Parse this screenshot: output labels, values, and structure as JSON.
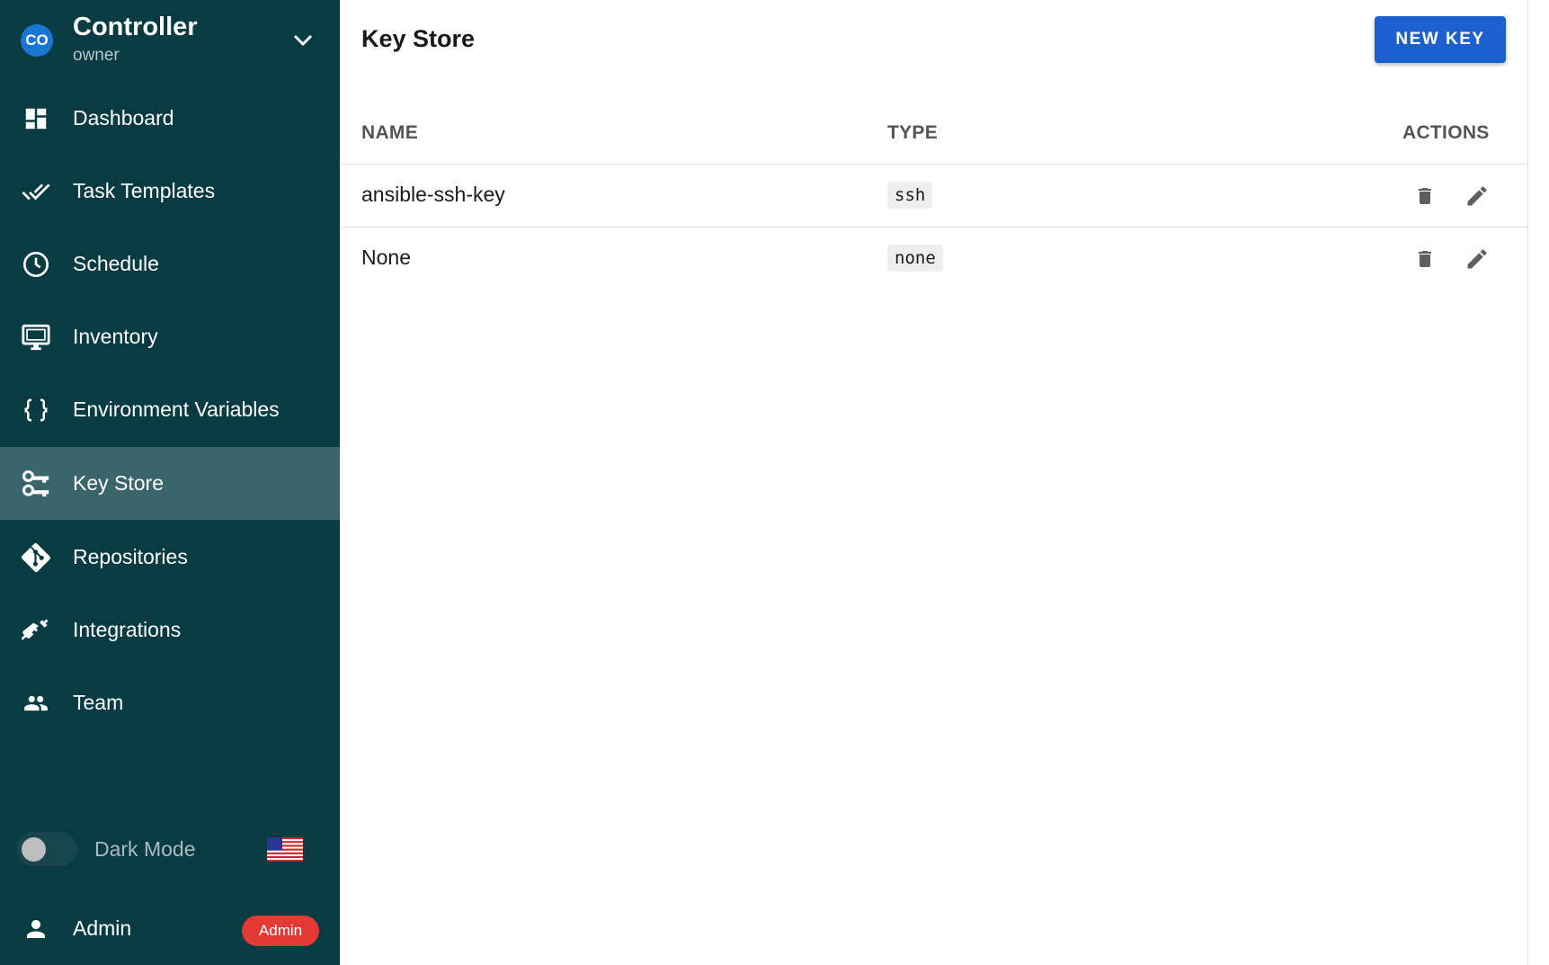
{
  "project": {
    "avatar": "CO",
    "name": "Controller",
    "role": "owner"
  },
  "sidebar": {
    "items": [
      {
        "label": "Dashboard",
        "icon": "dashboard-icon",
        "active": false
      },
      {
        "label": "Task Templates",
        "icon": "done-all-icon",
        "active": false
      },
      {
        "label": "Schedule",
        "icon": "clock-icon",
        "active": false
      },
      {
        "label": "Inventory",
        "icon": "monitor-icon",
        "active": false
      },
      {
        "label": "Environment Variables",
        "icon": "braces-icon",
        "active": false
      },
      {
        "label": "Key Store",
        "icon": "key-icon",
        "active": true
      },
      {
        "label": "Repositories",
        "icon": "git-icon",
        "active": false
      },
      {
        "label": "Integrations",
        "icon": "plug-icon",
        "active": false
      },
      {
        "label": "Team",
        "icon": "team-icon",
        "active": false
      }
    ],
    "dark_mode_label": "Dark Mode",
    "dark_mode_on": false,
    "user_label": "Admin",
    "user_badge": "Admin"
  },
  "main": {
    "title": "Key Store",
    "new_button": "NEW KEY",
    "columns": {
      "name": "NAME",
      "type": "TYPE",
      "actions": "ACTIONS"
    },
    "rows": [
      {
        "name": "ansible-ssh-key",
        "type": "ssh"
      },
      {
        "name": "None",
        "type": "none"
      }
    ]
  },
  "colors": {
    "sidebar_bg": "#093b43",
    "active_bg": "#3a666b",
    "primary": "#1c5fcf",
    "badge": "#e53935"
  }
}
